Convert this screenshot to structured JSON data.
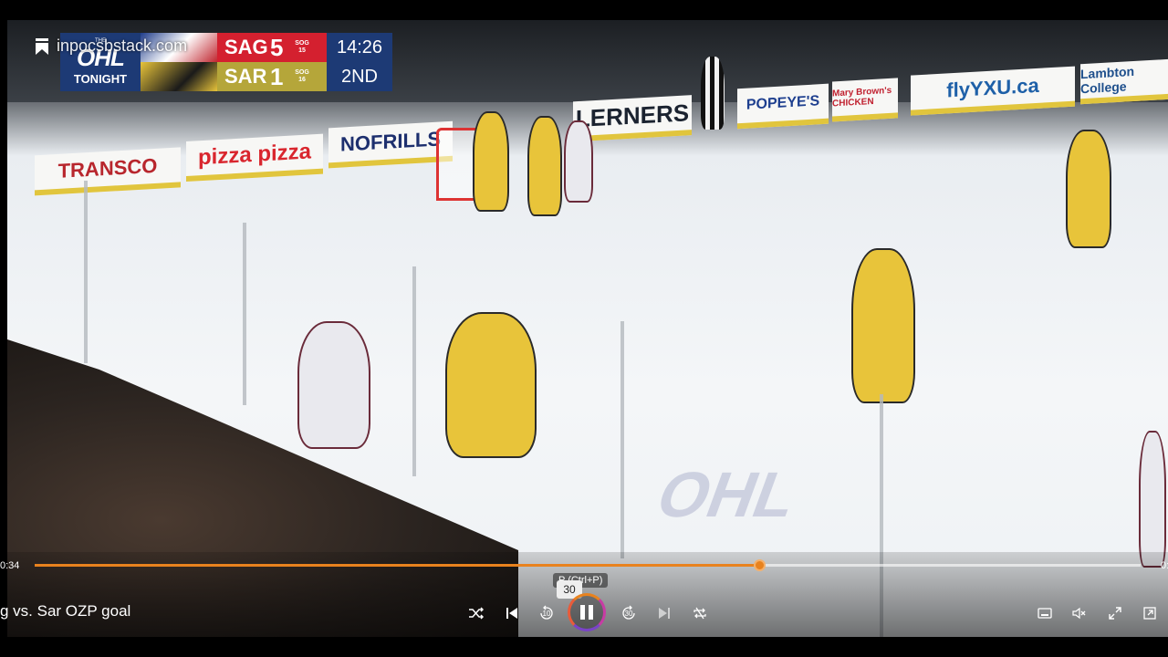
{
  "overlay": {
    "watermark": "inpocsbstack.com",
    "bookmark_icon": "bookmark-icon"
  },
  "scorebug": {
    "league_top": "THE",
    "league": "OHL",
    "league_sub": "TONIGHT",
    "home": {
      "abbr": "SAG",
      "score": "5",
      "sog_label": "SOG",
      "sog": "15",
      "color": "#d4202f"
    },
    "away": {
      "abbr": "SAR",
      "score": "1",
      "sog_label": "SOG",
      "sog": "16",
      "color": "#b5a63a"
    },
    "clock": "14:26",
    "period": "2ND"
  },
  "board_ads": [
    "TRANSCO",
    "pizza pizza",
    "NOFRILLS",
    "LERNERS",
    "POPEYE'S",
    "Mary Brown's CHICKEN",
    "flyYXU.ca",
    "Lambton College"
  ],
  "player": {
    "time_current": "0:34",
    "time_total": "0:",
    "progress": 0.655,
    "title": "g vs. Sar OZP goal",
    "tooltip": "P (Ctrl+P)",
    "tooltip_badge": "30",
    "controls": {
      "shuffle": "shuffle-icon",
      "previous": "skip-previous-icon",
      "rewind_label": "10",
      "forward_label": "30",
      "next": "skip-next-icon",
      "repeat": "repeat-icon",
      "miniplayer": "miniplayer-icon",
      "mute": "volume-muted-icon",
      "fullscreen": "fullscreen-icon",
      "popout": "popout-icon"
    }
  },
  "colors": {
    "accent": "#e8821e",
    "ohl_blue": "#1d3a75"
  }
}
